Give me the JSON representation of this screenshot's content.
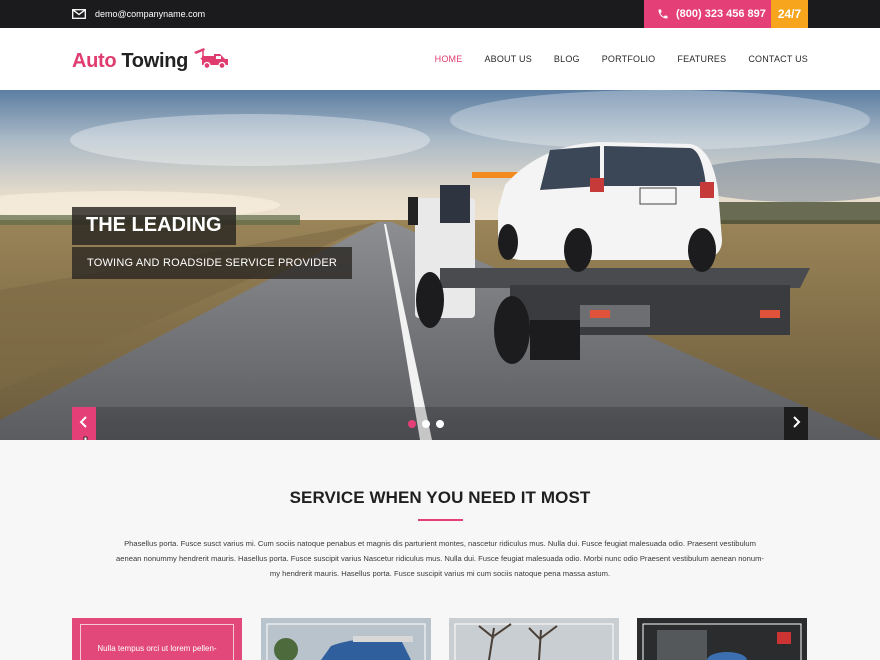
{
  "topbar": {
    "email": "demo@companyname.com",
    "email_icon": "envelope-icon",
    "phone": "(800) 323 456 897",
    "phone_icon": "phone-icon",
    "availability": "24/7"
  },
  "brand": {
    "word1": "Auto",
    "word2": "Towing",
    "logo_icon": "tow-truck-icon"
  },
  "nav": {
    "items": [
      {
        "label": "HOME",
        "active": true
      },
      {
        "label": "ABOUT US"
      },
      {
        "label": "BLOG"
      },
      {
        "label": "PORTFOLIO"
      },
      {
        "label": "FEATURES"
      },
      {
        "label": "CONTACT US"
      }
    ]
  },
  "hero": {
    "caption_title": "THE LEADING",
    "caption_sub": "TOWING AND ROADSIDE SERVICE PROVIDER",
    "prev_icon": "chevron-left-icon",
    "next_icon": "chevron-right-icon",
    "slide_count": 3,
    "active_slide": 1
  },
  "service": {
    "title": "SERVICE WHEN YOU NEED IT MOST",
    "lines": [
      "Phasellus porta. Fusce susct varius mi. Cum sociis natoque penabus et magnis dis parturient montes, nascetur ridiculus mus. Nulla dui. Fusce feugiat malesuada odio. Praesent vestibulum",
      "aenean nonummy hendrerit mauris. Hasellus porta. Fusce suscipit varius Nascetur ridiculus mus. Nulla dui. Fusce feugiat malesuada odio. Morbi nunc odio Praesent vestibulum aenean nonum-",
      "my hendrerit mauris. Hasellus porta. Fusce suscipit varius mi cum sociis natoque pena massa astum."
    ]
  },
  "cards": {
    "first_text": "Nulla tempus orci ut lorem pellen-"
  },
  "colors": {
    "accent": "#e53f78",
    "orange": "#f6a51d",
    "dark": "#1b1b1d"
  }
}
